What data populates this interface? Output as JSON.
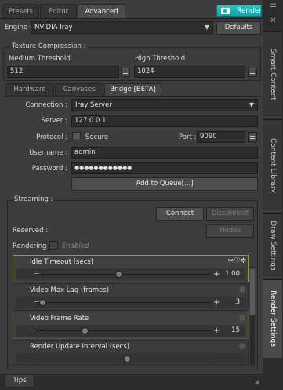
{
  "tabs": [
    {
      "label": "Presets"
    },
    {
      "label": "Editor"
    },
    {
      "label": "Advanced"
    }
  ],
  "render_button": {
    "label": "Render",
    "icon": "camera-icon",
    "color": "#17b0b0"
  },
  "engine": {
    "label": "Engine :",
    "value": "NVIDIA Iray",
    "defaults_label": "Defaults"
  },
  "texture": {
    "title": "Texture Compression :",
    "medium_label": "Medium Threshold",
    "medium_value": "512",
    "high_label": "High Threshold",
    "high_value": "1024"
  },
  "subtabs": [
    {
      "label": "Hardware"
    },
    {
      "label": "Canvases"
    },
    {
      "label": "Bridge [BETA]"
    }
  ],
  "bridge": {
    "connection_label": "Connection :",
    "connection_value": "Iray Server",
    "server_label": "Server :",
    "server_value": "127.0.0.1",
    "protocol_label": "Protocol :",
    "secure_label": "Secure",
    "port_label": "Port :",
    "port_value": "9090",
    "username_label": "Username :",
    "username_value": "admin",
    "password_label": "Password :",
    "password_value": "●●●●●●●●●●●●",
    "add_queue_label": "Add to Queue[...]"
  },
  "streaming": {
    "title": "Streaming :",
    "connect_label": "Connect",
    "disconnect_label": "Disconnect",
    "reserved_label": "Reserved :",
    "nodes_label": "Nodes",
    "rendering_label": "Rendering :",
    "enabled_label": "Enabled"
  },
  "sliders": [
    {
      "label": "Idle Timeout (secs)",
      "value": "1.00",
      "level": 0.45
    },
    {
      "label": "Video Max Lag (frames)",
      "value": "3",
      "level": 0.0
    },
    {
      "label": "Video Frame Rate",
      "value": "15",
      "level": 0.25
    },
    {
      "label": "Render Update Interval (secs)",
      "value": "",
      "level": 0.5
    }
  ],
  "side_tabs": [
    {
      "label": "Smart Content"
    },
    {
      "label": "Content Library"
    },
    {
      "label": "Draw Settings"
    },
    {
      "label": "Render Settings"
    }
  ],
  "bottom": {
    "tips_label": "Tips"
  },
  "colors": {
    "accent": "#17b0b0",
    "highlight_border": "#9a9a2a"
  }
}
